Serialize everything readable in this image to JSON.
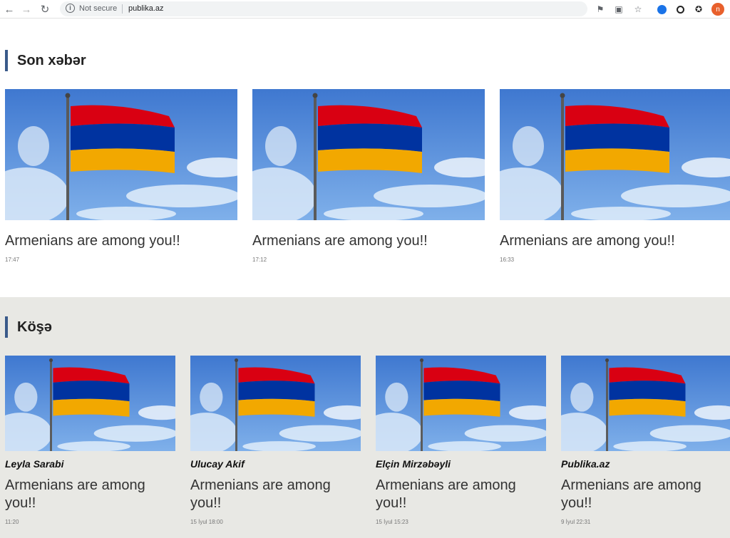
{
  "browser": {
    "back_icon": "arrow-left-icon",
    "forward_icon": "arrow-right-icon",
    "reload_icon": "reload-icon",
    "security_label": "Not secure",
    "url": "publika.az",
    "extensions": [
      "translate-icon",
      "star-icon",
      "extension-blue-icon",
      "chat-icon",
      "puzzle-icon"
    ],
    "profile_initial": "n"
  },
  "latest": {
    "heading": "Son xəbər",
    "items": [
      {
        "title": "Armenians are among you!!",
        "time": "17:47"
      },
      {
        "title": "Armenians are among you!!",
        "time": "17:12"
      },
      {
        "title": "Armenians are among you!!",
        "time": "16:33"
      }
    ]
  },
  "columns": {
    "heading": "Köşə",
    "items": [
      {
        "author": "Leyla Sarabi",
        "title": "Armenians are among you!!",
        "time": "11:20"
      },
      {
        "author": "Ulucay Akif",
        "title": "Armenians are among you!!",
        "time": "15 İyul 18:00"
      },
      {
        "author": "Elçin Mirzəbəyli",
        "title": "Armenians are among you!!",
        "time": "15 İyul 15:23"
      },
      {
        "author": "Publika.az",
        "title": "Armenians are among you!!",
        "time": "9 İyul 22:31"
      }
    ]
  },
  "colors": {
    "accent": "#3a5a8a",
    "flag_red": "#d90012",
    "flag_blue": "#0033a0",
    "flag_orange": "#f2a800"
  }
}
